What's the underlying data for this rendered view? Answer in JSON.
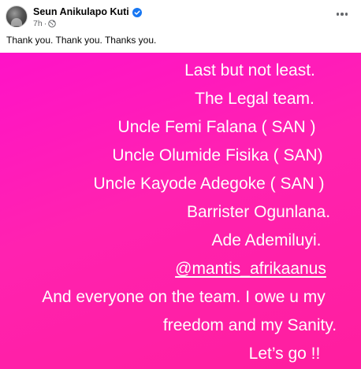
{
  "post": {
    "author_name": "Seun Anikulapo Kuti",
    "timestamp": "7h",
    "audience_icon": "globe-icon",
    "verified_icon": "verified-badge-icon",
    "more_icon": "more-options-icon",
    "caption": "Thank you. Thank you. Thanks you."
  },
  "story": {
    "background_color": "#ff1ec0",
    "text_color": "#ffffff",
    "lines": [
      "Last but not least.",
      "The Legal team.",
      "Uncle Femi Falana ( SAN )",
      "Uncle Olumide Fisika ( SAN)",
      "Uncle Kayode Adegoke ( SAN )",
      "Barrister Ogunlana.",
      "Ade Ademiluyi.",
      "@mantis_afrikaanus",
      "And everyone on the team. I owe u my",
      "freedom and my Sanity.",
      "Let’s go !!"
    ]
  }
}
